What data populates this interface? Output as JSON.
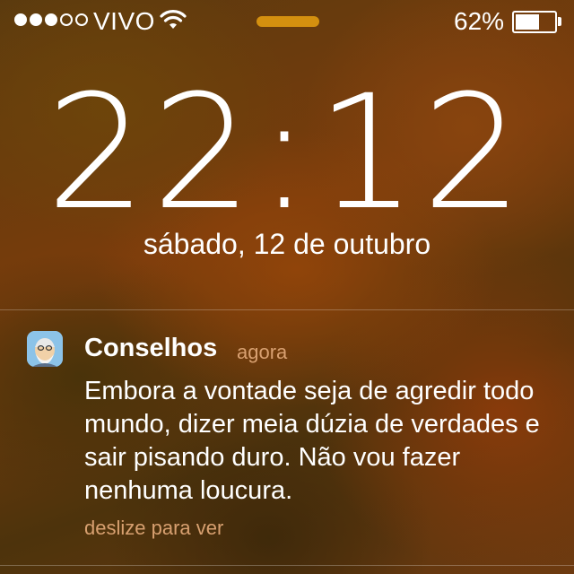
{
  "status_bar": {
    "signal_bars_filled": 3,
    "signal_bars_total": 5,
    "carrier": "VIVO",
    "wifi_icon": "wifi-icon",
    "battery_percent_label": "62%",
    "battery_level": 0.62
  },
  "lock_screen": {
    "time_hours": "22",
    "time_minutes": "12",
    "date": "sábado, 12 de outubro"
  },
  "notification": {
    "app_icon": "app-icon-conselhos",
    "app_name": "Conselhos",
    "time": "agora",
    "message": "Embora a vontade seja de agredir todo mundo, dizer meia dúzia de verdades e sair pisando duro. Não vou fazer nenhuma loucura.",
    "action_hint": "deslize para ver"
  },
  "colors": {
    "accent_pill": "#d4900f",
    "secondary_text": "#d8a070"
  }
}
